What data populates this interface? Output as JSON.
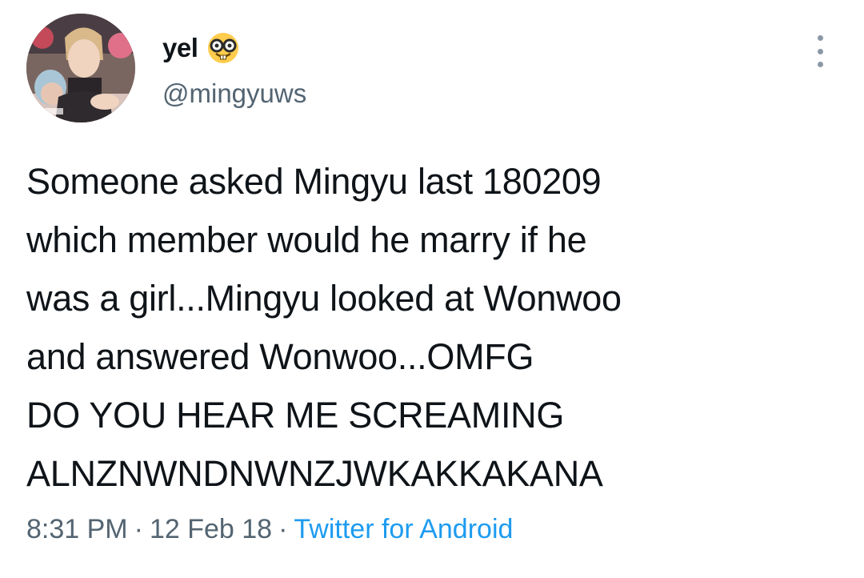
{
  "user": {
    "display_name": "yel",
    "handle": "@mingyuws",
    "emoji": "nerd-face-icon"
  },
  "tweet": {
    "lines": [
      "Someone asked Mingyu last 180209",
      "which member would he marry if he",
      "was a girl...Mingyu looked at Wonwoo",
      "and answered Wonwoo...OMFG",
      "DO YOU HEAR ME SCREAMING",
      "ALNZNWNDNWNZJWKAKKAKANA"
    ]
  },
  "meta": {
    "time": "8:31 PM",
    "separator": "·",
    "date": "12 Feb 18",
    "source": "Twitter for Android"
  },
  "colors": {
    "text": "#0f1419",
    "secondary": "#536471",
    "link": "#1d9bf0"
  }
}
